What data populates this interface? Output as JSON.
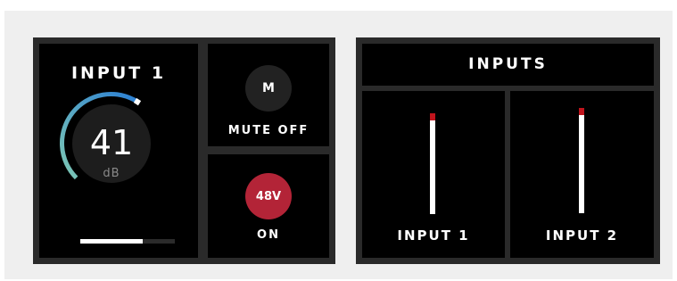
{
  "channel": {
    "title": "INPUT 1",
    "gain_value": "41",
    "gain_unit": "dB",
    "gain_knob_fraction": 0.62,
    "level_fraction": 0.66,
    "colors": {
      "arc_start": "#7ec8b4",
      "arc_end": "#2b7fd4",
      "knob_bg": "#1d1d1d"
    }
  },
  "mute": {
    "button_label": "M",
    "state_label": "MUTE OFF"
  },
  "phantom": {
    "button_label": "48V",
    "state_label": "ON",
    "color": "#b32437"
  },
  "inputs_panel": {
    "title": "INPUTS",
    "meters": [
      {
        "label": "INPUT 1",
        "peak_fraction": 0.07
      },
      {
        "label": "INPUT 2",
        "peak_fraction": 0.07
      }
    ],
    "peak_color": "#c0141c"
  }
}
